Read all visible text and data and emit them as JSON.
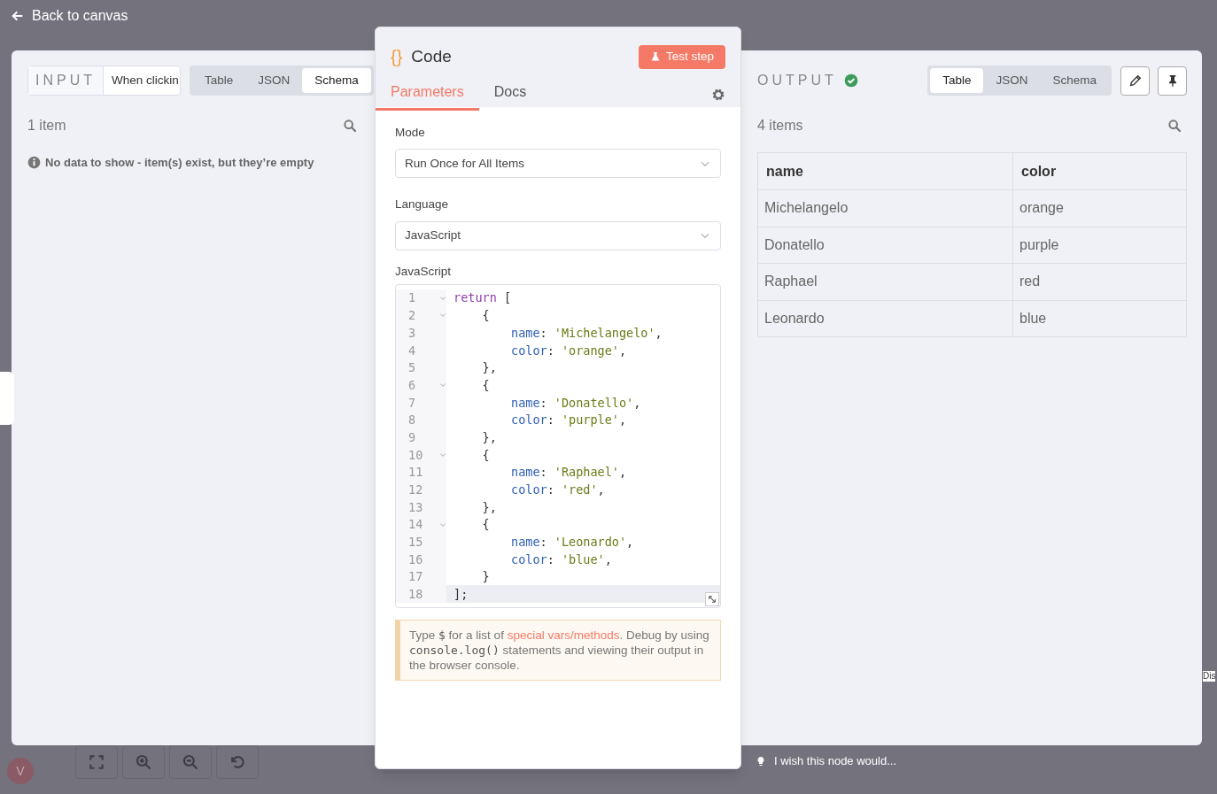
{
  "back_link": {
    "label": "Back to canvas"
  },
  "input": {
    "title": "INPUT",
    "trigger": "When clickin",
    "view_tabs": [
      {
        "label": "Table",
        "selected": false
      },
      {
        "label": "JSON",
        "selected": false
      },
      {
        "label": "Schema",
        "selected": true
      }
    ],
    "count": "1 item",
    "notice": "No data to show - item(s) exist, but they’re empty"
  },
  "node": {
    "icon": "{}",
    "title": "Code",
    "test_button": "Test step",
    "tabs": [
      {
        "label": "Parameters",
        "selected": true
      },
      {
        "label": "Docs",
        "selected": false
      }
    ],
    "fields": [
      {
        "label": "Mode",
        "value": "Run Once for All Items"
      },
      {
        "label": "Language",
        "value": "JavaScript"
      }
    ],
    "editor": {
      "label": "JavaScript",
      "lines": [
        {
          "number": "1",
          "foldable": true,
          "active": false,
          "tokens": [
            {
              "kind": "keyword",
              "text": "return"
            },
            {
              "kind": "punct",
              "text": " ["
            }
          ]
        },
        {
          "number": "2",
          "foldable": true,
          "active": false,
          "tokens": [
            {
              "kind": "punct",
              "text": "    {"
            }
          ]
        },
        {
          "number": "3",
          "foldable": false,
          "active": false,
          "tokens": [
            {
              "kind": "property",
              "text": "        name"
            },
            {
              "kind": "punct",
              "text": ": "
            },
            {
              "kind": "string",
              "text": "'Michelangelo'"
            },
            {
              "kind": "punct",
              "text": ","
            }
          ]
        },
        {
          "number": "4",
          "foldable": false,
          "active": false,
          "tokens": [
            {
              "kind": "property",
              "text": "        color"
            },
            {
              "kind": "punct",
              "text": ": "
            },
            {
              "kind": "string",
              "text": "'orange'"
            },
            {
              "kind": "punct",
              "text": ","
            }
          ]
        },
        {
          "number": "5",
          "foldable": false,
          "active": false,
          "tokens": [
            {
              "kind": "punct",
              "text": "    },"
            }
          ]
        },
        {
          "number": "6",
          "foldable": true,
          "active": false,
          "tokens": [
            {
              "kind": "punct",
              "text": "    {"
            }
          ]
        },
        {
          "number": "7",
          "foldable": false,
          "active": false,
          "tokens": [
            {
              "kind": "property",
              "text": "        name"
            },
            {
              "kind": "punct",
              "text": ": "
            },
            {
              "kind": "string",
              "text": "'Donatello'"
            },
            {
              "kind": "punct",
              "text": ","
            }
          ]
        },
        {
          "number": "8",
          "foldable": false,
          "active": false,
          "tokens": [
            {
              "kind": "property",
              "text": "        color"
            },
            {
              "kind": "punct",
              "text": ": "
            },
            {
              "kind": "string",
              "text": "'purple'"
            },
            {
              "kind": "punct",
              "text": ","
            }
          ]
        },
        {
          "number": "9",
          "foldable": false,
          "active": false,
          "tokens": [
            {
              "kind": "punct",
              "text": "    },"
            }
          ]
        },
        {
          "number": "10",
          "foldable": true,
          "active": false,
          "tokens": [
            {
              "kind": "punct",
              "text": "    {"
            }
          ]
        },
        {
          "number": "11",
          "foldable": false,
          "active": false,
          "tokens": [
            {
              "kind": "property",
              "text": "        name"
            },
            {
              "kind": "punct",
              "text": ": "
            },
            {
              "kind": "string",
              "text": "'Raphael'"
            },
            {
              "kind": "punct",
              "text": ","
            }
          ]
        },
        {
          "number": "12",
          "foldable": false,
          "active": false,
          "tokens": [
            {
              "kind": "property",
              "text": "        color"
            },
            {
              "kind": "punct",
              "text": ": "
            },
            {
              "kind": "string",
              "text": "'red'"
            },
            {
              "kind": "punct",
              "text": ","
            }
          ]
        },
        {
          "number": "13",
          "foldable": false,
          "active": false,
          "tokens": [
            {
              "kind": "punct",
              "text": "    },"
            }
          ]
        },
        {
          "number": "14",
          "foldable": true,
          "active": false,
          "tokens": [
            {
              "kind": "punct",
              "text": "    {"
            }
          ]
        },
        {
          "number": "15",
          "foldable": false,
          "active": false,
          "tokens": [
            {
              "kind": "property",
              "text": "        name"
            },
            {
              "kind": "punct",
              "text": ": "
            },
            {
              "kind": "string",
              "text": "'Leonardo'"
            },
            {
              "kind": "punct",
              "text": ","
            }
          ]
        },
        {
          "number": "16",
          "foldable": false,
          "active": false,
          "tokens": [
            {
              "kind": "property",
              "text": "        color"
            },
            {
              "kind": "punct",
              "text": ": "
            },
            {
              "kind": "string",
              "text": "'blue'"
            },
            {
              "kind": "punct",
              "text": ","
            }
          ]
        },
        {
          "number": "17",
          "foldable": false,
          "active": false,
          "tokens": [
            {
              "kind": "punct",
              "text": "    }"
            }
          ]
        },
        {
          "number": "18",
          "foldable": false,
          "active": true,
          "tokens": [
            {
              "kind": "punct",
              "text": "];"
            }
          ]
        }
      ]
    },
    "hint": [
      {
        "kind": "text",
        "text": "Type "
      },
      {
        "kind": "code",
        "text": "$"
      },
      {
        "kind": "text",
        "text": " for a list of "
      },
      {
        "kind": "link",
        "text": "special vars/methods"
      },
      {
        "kind": "text",
        "text": ". Debug by using "
      },
      {
        "kind": "code",
        "text": "console.log()"
      },
      {
        "kind": "text",
        "text": " statements and viewing their output in the browser console."
      }
    ]
  },
  "output": {
    "title": "OUTPUT",
    "success": true,
    "view_tabs": [
      {
        "label": "Table",
        "selected": true
      },
      {
        "label": "JSON",
        "selected": false
      },
      {
        "label": "Schema",
        "selected": false
      }
    ],
    "count": "4 items",
    "table": {
      "columns": [
        "name",
        "color"
      ],
      "rows": [
        [
          "Michelangelo",
          "orange"
        ],
        [
          "Donatello",
          "purple"
        ],
        [
          "Raphael",
          "red"
        ],
        [
          "Leonardo",
          "blue"
        ]
      ]
    }
  },
  "feedback": "I wish this node would...",
  "canvas": {
    "avatar": "V",
    "node_fragment": "Dis"
  }
}
